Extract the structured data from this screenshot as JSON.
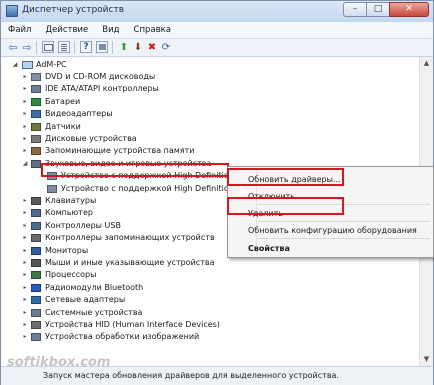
{
  "window": {
    "title": "Диспетчер устройств",
    "controls": {
      "minimize": "–",
      "maximize": "□",
      "close": "✕"
    }
  },
  "menu": [
    "Файл",
    "Действие",
    "Вид",
    "Справка"
  ],
  "toolbar_icons": [
    "back-arrow-icon",
    "forward-arrow-icon",
    "computer-view-icon",
    "properties-icon",
    "help-icon",
    "device-view-icon",
    "update-driver-icon",
    "disable-device-icon",
    "uninstall-device-icon",
    "scan-hardware-icon"
  ],
  "tree": {
    "root": "AdM-PC",
    "items": [
      {
        "label": "DVD и CD-ROM дисководы",
        "icon": "dvd-drive-icon",
        "expander": "▸"
      },
      {
        "label": "IDE ATA/ATAPI контроллеры",
        "icon": "ide-controller-icon",
        "expander": "▸"
      },
      {
        "label": "Батареи",
        "icon": "battery-icon",
        "expander": "▸"
      },
      {
        "label": "Видеоадаптеры",
        "icon": "display-adapter-icon",
        "expander": "▸"
      },
      {
        "label": "Датчики",
        "icon": "sensor-icon",
        "expander": "▸"
      },
      {
        "label": "Дисковые устройства",
        "icon": "disk-drive-icon",
        "expander": "▸"
      },
      {
        "label": "Запоминающие устройства памяти",
        "icon": "memory-device-icon",
        "expander": "▸"
      },
      {
        "label": "Звуковые, видео и игровые устройства",
        "icon": "sound-device-icon",
        "expander": "◢"
      },
      {
        "label": "Устройство с поддержкой High Definition A...",
        "icon": "audio-device-icon",
        "expander": "",
        "child": true
      },
      {
        "label": "Устройство с поддержкой High Definition Au...",
        "icon": "audio-device-icon",
        "expander": "",
        "child": true
      },
      {
        "label": "Клавиатуры",
        "icon": "keyboard-icon",
        "expander": "▸"
      },
      {
        "label": "Компьютер",
        "icon": "computer-icon",
        "expander": "▸"
      },
      {
        "label": "Контроллеры USB",
        "icon": "usb-controller-icon",
        "expander": "▸"
      },
      {
        "label": "Контроллеры запоминающих устройств",
        "icon": "storage-controller-icon",
        "expander": "▸"
      },
      {
        "label": "Мониторы",
        "icon": "monitor-icon",
        "expander": "▸"
      },
      {
        "label": "Мыши и иные указывающие устройства",
        "icon": "mouse-icon",
        "expander": "▸"
      },
      {
        "label": "Процессоры",
        "icon": "processor-icon",
        "expander": "▸"
      },
      {
        "label": "Радиомодули Bluetooth",
        "icon": "bluetooth-icon",
        "expander": "▸"
      },
      {
        "label": "Сетевые адаптеры",
        "icon": "network-adapter-icon",
        "expander": "▸"
      },
      {
        "label": "Системные устройства",
        "icon": "system-device-icon",
        "expander": "▸"
      },
      {
        "label": "Устройства HID (Human Interface Devices)",
        "icon": "hid-device-icon",
        "expander": "▸"
      },
      {
        "label": "Устройства обработки изображений",
        "icon": "imaging-device-icon",
        "expander": "▸"
      }
    ]
  },
  "context_menu": {
    "items": [
      "Обновить драйверы...",
      "Отключить",
      "Удалить",
      "Обновить конфигурацию оборудования",
      "Свойства"
    ]
  },
  "status_bar": {
    "text": "Запуск мастера обновления драйверов для выделенного устройства."
  },
  "watermark": "softikbox.com",
  "colors": {
    "highlight": "#d9161f",
    "titlebar": "#c5d7ee",
    "close_button": "#c9493a"
  }
}
